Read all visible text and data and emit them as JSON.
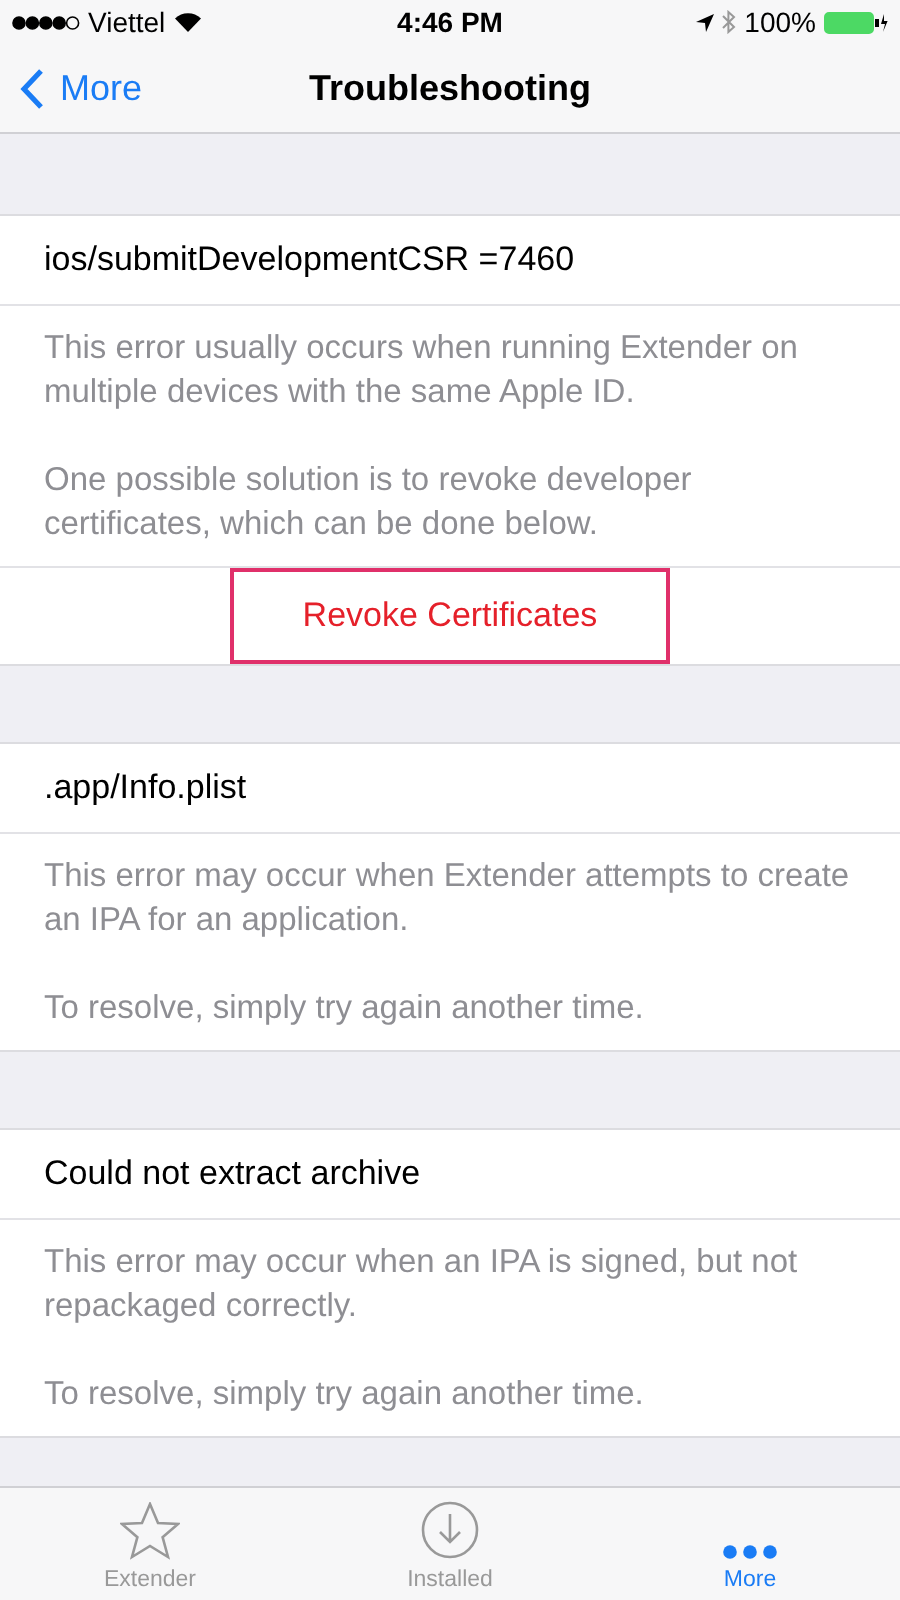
{
  "status_bar": {
    "carrier": "Viettel",
    "time": "4:46 PM",
    "battery": "100%"
  },
  "nav": {
    "back": "More",
    "title": "Troubleshooting"
  },
  "sections": [
    {
      "title": "ios/submitDevelopmentCSR =7460",
      "paragraphs": [
        "This error usually occurs when running Extender on multiple devices with the same Apple ID.",
        "One possible solution is to revoke developer certificates, which can be done below."
      ],
      "action": {
        "label": "Revoke Certificates",
        "highlighted": true
      }
    },
    {
      "title": ".app/Info.plist",
      "paragraphs": [
        "This error may occur when Extender attempts to create an IPA for an application.",
        "To resolve, simply try again another time."
      ]
    },
    {
      "title": "Could not extract archive",
      "paragraphs": [
        "This error may occur when an IPA is signed, but not repackaged correctly.",
        "To resolve, simply try again another time."
      ]
    }
  ],
  "tabs": [
    {
      "label": "Extender",
      "kind": "star",
      "selected": false
    },
    {
      "label": "Installed",
      "kind": "download",
      "selected": false
    },
    {
      "label": "More",
      "kind": "more",
      "selected": true
    }
  ]
}
